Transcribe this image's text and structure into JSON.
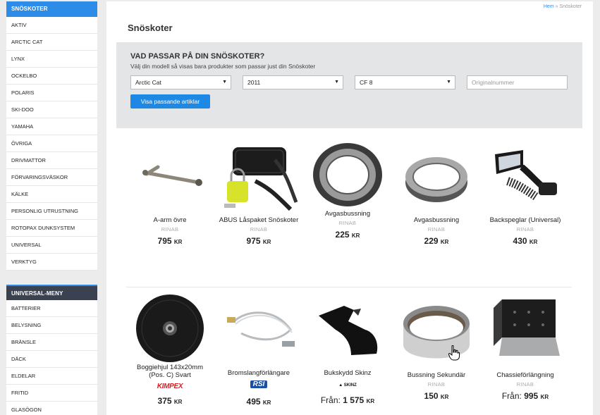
{
  "sidebar": {
    "header": "SNÖSKOTER",
    "items": [
      "AKTIV",
      "ARCTIC CAT",
      "LYNX",
      "OCKELBO",
      "POLARIS",
      "SKI-DOO",
      "YAMAHA",
      "ÖVRIGA",
      "DRIVMATTOR",
      "FÖRVARINGSVÄSKOR",
      "KÄLKE",
      "PERSONLIG UTRUSTNING",
      "ROTOPAX DUNKSYSTEM",
      "UNIVERSAL",
      "VERKTYG"
    ],
    "header2": "UNIVERSAL-MENY",
    "items2": [
      "BATTERIER",
      "BELYSNING",
      "BRÄNSLE",
      "DÄCK",
      "ELDELAR",
      "FRITID",
      "GLASÖGON"
    ]
  },
  "breadcrumb": {
    "home": "Hem",
    "sep": "»",
    "current": "Snöskoter"
  },
  "page_title": "Snöskoter",
  "finder": {
    "title": "VAD PASSAR PÅ DIN SNÖSKOTER?",
    "subtitle": "Välj din modell så visas bara produkter som passar just din Snöskoter",
    "brand_value": "Arctic Cat",
    "year_value": "2011",
    "model_value": "CF 8",
    "original_placeholder": "Originalnummer",
    "button": "Visa passande artiklar"
  },
  "products": [
    {
      "name": "A-arm övre",
      "brand": "RINAB",
      "price": "795",
      "currency": "KR",
      "prefix": ""
    },
    {
      "name": "ABUS Låspaket Snöskoter",
      "brand": "RINAB",
      "price": "975",
      "currency": "KR",
      "prefix": ""
    },
    {
      "name": "Avgasbussning",
      "brand": "RINAB",
      "price": "225",
      "currency": "KR",
      "prefix": ""
    },
    {
      "name": "Avgasbussning",
      "brand": "RINAB",
      "price": "229",
      "currency": "KR",
      "prefix": ""
    },
    {
      "name": "Backspeglar (Universal)",
      "brand": "RINAB",
      "price": "430",
      "currency": "KR",
      "prefix": ""
    },
    {
      "name": "Boggiehjul 143x20mm",
      "name2": "(Pos. C) Svart",
      "brand": "KIMPEX",
      "price": "375",
      "currency": "KR",
      "prefix": ""
    },
    {
      "name": "Bromslangförlängare",
      "brand": "RSI",
      "price": "495",
      "currency": "KR",
      "prefix": ""
    },
    {
      "name": "Bukskydd Skinz",
      "brand": "SKINZ",
      "price": "1 575",
      "currency": "KR",
      "prefix": "Från:"
    },
    {
      "name": "Bussning Sekundär",
      "brand": "RINAB",
      "price": "150",
      "currency": "KR",
      "prefix": ""
    },
    {
      "name": "Chassieförlängning",
      "brand": "RINAB",
      "price": "995",
      "currency": "KR",
      "prefix": "Från:"
    }
  ],
  "colors": {
    "accent": "#2d8ce8",
    "dark_header": "#3a4150",
    "kimpex": "#d81f26",
    "rsi": "#1a4fa3"
  }
}
